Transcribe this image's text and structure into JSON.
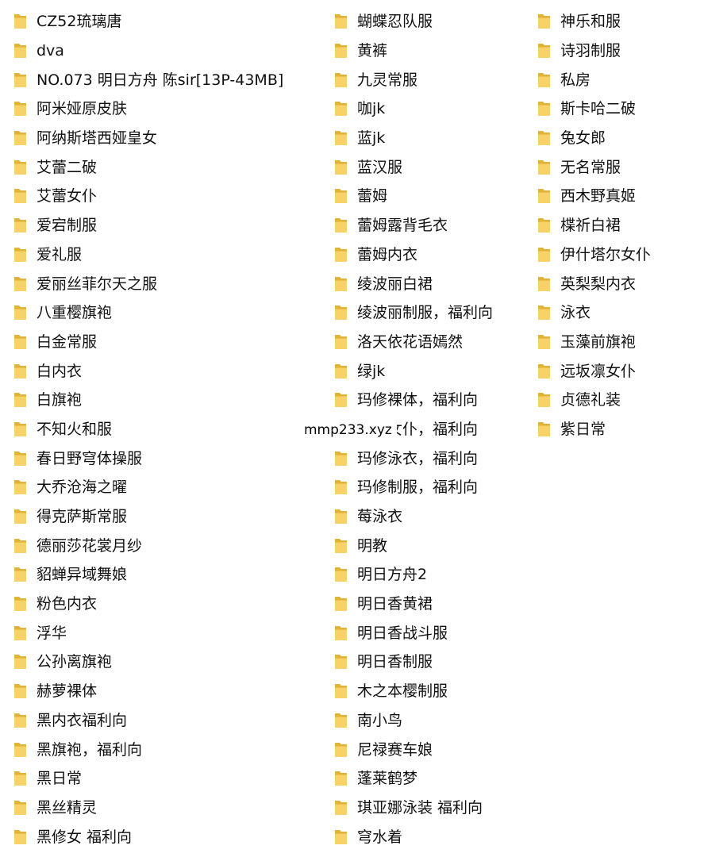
{
  "colors": {
    "folder_back": "#e2b33b",
    "folder_front": "#f7d26a",
    "text": "#111111"
  },
  "icon": "folder-icon",
  "columns": [
    {
      "items": [
        "CZ52琉璃唐",
        "dva",
        "NO.073 明日方舟 陈sir[13P-43MB]",
        "阿米娅原皮肤",
        "阿纳斯塔西娅皇女",
        "艾蕾二破",
        "艾蕾女仆",
        "爱宕制服",
        "爱礼服",
        "爱丽丝菲尔天之服",
        "八重樱旗袍",
        "白金常服",
        "白内衣",
        "白旗袍",
        "不知火和服",
        "春日野穹体操服",
        "大乔沧海之曜",
        "得克萨斯常服",
        "德丽莎花裳月纱",
        "貂蝉异域舞娘",
        "粉色内衣",
        "浮华",
        "公孙离旗袍",
        "赫萝裸体",
        "黑内衣福利向",
        "黑旗袍，福利向",
        "黑日常",
        "黑丝精灵",
        "黑修女 福利向"
      ]
    },
    {
      "items": [
        "蝴蝶忍队服",
        "黄裤",
        "九灵常服",
        "咖jk",
        "蓝jk",
        "蓝汉服",
        "蕾姆",
        "蕾姆露背毛衣",
        "蕾姆内衣",
        "绫波丽白裙",
        "绫波丽制服，福利向",
        "洛天依花语嫣然",
        "绿jk",
        "玛修裸体，福利向",
        "玛修女仆，福利向",
        "玛修泳衣，福利向",
        "玛修制服，福利向",
        "莓泳衣",
        "明教",
        "明日方舟2",
        "明日香黄裙",
        "明日香战斗服",
        "明日香制服",
        "木之本樱制服",
        "南小鸟",
        "尼禄赛车娘",
        "蓬莱鹤梦",
        "琪亚娜泳装 福利向",
        "穹水着"
      ]
    },
    {
      "items": [
        "神乐和服",
        "诗羽制服",
        "私房",
        "斯卡哈二破",
        "兔女郎",
        "无名常服",
        "西木野真姬",
        "楪祈白裙",
        "伊什塔尔女仆",
        "英梨梨内衣",
        "泳衣",
        "玉藻前旗袍",
        "远坂凛女仆",
        "贞德礼装",
        "紫日常"
      ]
    }
  ],
  "watermark": "mmp233.xyz"
}
